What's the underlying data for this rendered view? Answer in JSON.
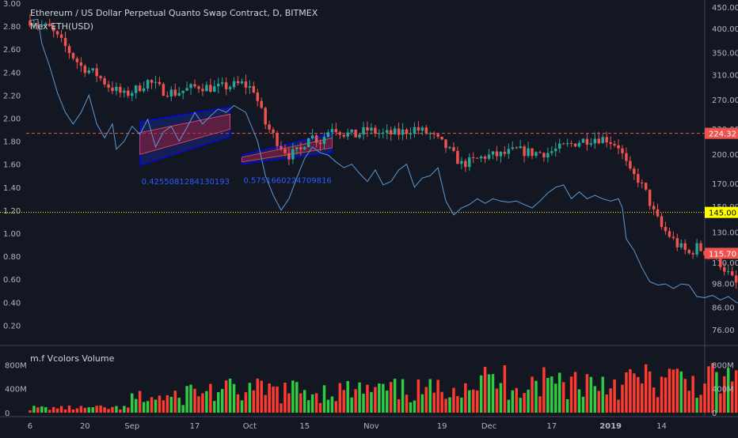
{
  "chart_data": {
    "type": "candlestick",
    "main_pane": {
      "title": "Ethereum / US Dollar Perpetual Quanto Swap Contract, D, BITMEX",
      "overlay_label": "Mex ETH(USD)",
      "left_axis": {
        "ticks": [
          "3.00",
          "2.80",
          "2.60",
          "2.40",
          "2.20",
          "2.00",
          "1.80",
          "1.60",
          "1.40",
          "1.20",
          "1.00",
          "0.80",
          "0.60",
          "0.40",
          "0.20"
        ],
        "range": [
          0.1,
          3.0
        ]
      },
      "right_axis": {
        "ticks": [
          "450.00",
          "400.00",
          "350.00",
          "310.00",
          "270.00",
          "230.00",
          "200.00",
          "170.00",
          "150.00",
          "130.00",
          "110.00",
          "98.00",
          "86.00",
          "76.00"
        ],
        "scale": "log",
        "range": [
          73,
          460
        ]
      },
      "markers": [
        {
          "label": "224.32",
          "price": 224.32,
          "color": "#ef5350",
          "style": "dashed"
        },
        {
          "label": "145.00",
          "price": 145.0,
          "color": "#ffff00",
          "style": "dotted"
        },
        {
          "label": "115.70",
          "price": 115.7,
          "color": "#ef5350",
          "style": "last"
        }
      ],
      "channel_labels": [
        "0.4255081284130193",
        "0.5751660224709816"
      ],
      "close_path": [
        [
          0,
          2.85
        ],
        [
          5,
          2.78
        ],
        [
          9,
          2.62
        ],
        [
          13,
          2.45
        ],
        [
          17,
          2.38
        ],
        [
          20,
          2.28
        ],
        [
          24,
          2.2
        ],
        [
          27,
          2.25
        ],
        [
          30,
          2.32
        ],
        [
          34,
          2.24
        ],
        [
          37,
          2.22
        ],
        [
          40,
          2.25
        ],
        [
          43,
          2.28
        ],
        [
          47,
          2.26
        ],
        [
          51,
          2.28
        ],
        [
          54,
          2.3
        ],
        [
          57,
          2.25
        ],
        [
          60,
          1.95
        ],
        [
          63,
          1.8
        ],
        [
          66,
          1.68
        ],
        [
          69,
          1.72
        ],
        [
          71,
          1.86
        ],
        [
          74,
          1.8
        ],
        [
          77,
          1.93
        ],
        [
          80,
          1.87
        ],
        [
          83,
          1.85
        ],
        [
          86,
          1.9
        ],
        [
          90,
          1.86
        ],
        [
          94,
          1.87
        ],
        [
          98,
          1.91
        ],
        [
          102,
          1.86
        ],
        [
          106,
          1.75
        ],
        [
          110,
          1.6
        ],
        [
          113,
          1.63
        ],
        [
          116,
          1.67
        ],
        [
          120,
          1.68
        ],
        [
          124,
          1.72
        ],
        [
          128,
          1.7
        ],
        [
          132,
          1.7
        ],
        [
          136,
          1.75
        ],
        [
          140,
          1.8
        ],
        [
          144,
          1.83
        ],
        [
          147,
          1.82
        ],
        [
          150,
          1.76
        ],
        [
          153,
          1.52
        ],
        [
          155,
          1.47
        ],
        [
          157,
          1.35
        ],
        [
          159,
          1.18
        ],
        [
          161,
          1.05
        ],
        [
          163,
          0.98
        ],
        [
          165,
          0.9
        ],
        [
          168,
          0.82
        ],
        [
          170,
          0.88
        ],
        [
          173,
          0.82
        ],
        [
          176,
          0.74
        ],
        [
          179,
          0.6
        ],
        [
          182,
          0.48
        ],
        [
          185,
          0.43
        ],
        [
          188,
          0.41
        ],
        [
          190,
          0.38
        ],
        [
          192,
          0.37
        ],
        [
          195,
          0.55
        ],
        [
          198,
          0.72
        ],
        [
          201,
          0.85
        ],
        [
          204,
          0.99
        ],
        [
          206,
          1.05
        ],
        [
          209,
          0.92
        ],
        [
          212,
          0.95
        ],
        [
          215,
          1.1
        ],
        [
          217,
          1.25
        ],
        [
          220,
          1.33
        ],
        [
          223,
          1.3
        ],
        [
          226,
          1.22
        ],
        [
          228,
          1.1
        ],
        [
          230,
          0.96
        ],
        [
          233,
          0.93
        ],
        [
          236,
          0.91
        ],
        [
          239,
          0.88
        ],
        [
          242,
          0.85
        ]
      ],
      "overlay_path": [
        [
          0,
          2.85
        ],
        [
          2,
          2.86
        ],
        [
          3,
          2.65
        ],
        [
          5,
          2.45
        ],
        [
          7,
          2.22
        ],
        [
          9,
          2.05
        ],
        [
          11,
          1.95
        ],
        [
          13,
          2.05
        ],
        [
          15,
          2.2
        ],
        [
          17,
          1.95
        ],
        [
          19,
          1.83
        ],
        [
          21,
          1.95
        ],
        [
          22,
          1.73
        ],
        [
          24,
          1.8
        ],
        [
          26,
          1.93
        ],
        [
          28,
          1.86
        ],
        [
          30,
          1.99
        ],
        [
          32,
          1.75
        ],
        [
          34,
          1.88
        ],
        [
          36,
          1.93
        ],
        [
          38,
          1.8
        ],
        [
          40,
          1.92
        ],
        [
          42,
          2.05
        ],
        [
          44,
          1.95
        ],
        [
          46,
          2.02
        ],
        [
          48,
          2.08
        ],
        [
          50,
          2.05
        ],
        [
          52,
          2.11
        ],
        [
          55,
          2.05
        ],
        [
          58,
          1.8
        ],
        [
          60,
          1.5
        ],
        [
          62,
          1.33
        ],
        [
          64,
          1.2
        ],
        [
          66,
          1.3
        ],
        [
          68,
          1.48
        ],
        [
          70,
          1.65
        ],
        [
          72,
          1.75
        ],
        [
          74,
          1.7
        ],
        [
          76,
          1.68
        ],
        [
          78,
          1.62
        ],
        [
          80,
          1.57
        ],
        [
          82,
          1.6
        ],
        [
          84,
          1.52
        ],
        [
          86,
          1.45
        ],
        [
          88,
          1.55
        ],
        [
          90,
          1.42
        ],
        [
          92,
          1.45
        ],
        [
          94,
          1.55
        ],
        [
          96,
          1.6
        ],
        [
          98,
          1.4
        ],
        [
          100,
          1.48
        ],
        [
          102,
          1.5
        ],
        [
          104,
          1.57
        ],
        [
          106,
          1.28
        ],
        [
          108,
          1.16
        ],
        [
          110,
          1.22
        ],
        [
          112,
          1.25
        ],
        [
          114,
          1.3
        ],
        [
          116,
          1.26
        ],
        [
          118,
          1.3
        ],
        [
          120,
          1.28
        ],
        [
          122,
          1.27
        ],
        [
          124,
          1.28
        ],
        [
          126,
          1.25
        ],
        [
          128,
          1.22
        ],
        [
          130,
          1.28
        ],
        [
          132,
          1.35
        ],
        [
          134,
          1.4
        ],
        [
          136,
          1.42
        ],
        [
          138,
          1.3
        ],
        [
          140,
          1.36
        ],
        [
          142,
          1.3
        ],
        [
          144,
          1.33
        ],
        [
          146,
          1.3
        ],
        [
          148,
          1.28
        ],
        [
          150,
          1.3
        ],
        [
          151,
          1.22
        ],
        [
          152,
          0.95
        ],
        [
          154,
          0.85
        ],
        [
          156,
          0.7
        ],
        [
          158,
          0.58
        ],
        [
          160,
          0.55
        ],
        [
          162,
          0.56
        ],
        [
          164,
          0.52
        ],
        [
          166,
          0.56
        ],
        [
          168,
          0.55
        ],
        [
          170,
          0.45
        ],
        [
          172,
          0.44
        ],
        [
          174,
          0.46
        ],
        [
          176,
          0.42
        ],
        [
          178,
          0.45
        ],
        [
          180,
          0.4
        ],
        [
          182,
          0.38
        ],
        [
          184,
          0.36
        ],
        [
          186,
          0.33
        ],
        [
          188,
          0.31
        ],
        [
          190,
          0.3
        ],
        [
          192,
          0.32
        ],
        [
          194,
          0.35
        ],
        [
          196,
          0.42
        ],
        [
          198,
          0.5
        ],
        [
          200,
          0.55
        ],
        [
          202,
          0.52
        ],
        [
          204,
          0.6
        ],
        [
          206,
          0.56
        ],
        [
          208,
          0.52
        ],
        [
          210,
          0.48
        ],
        [
          212,
          0.55
        ],
        [
          214,
          0.57
        ],
        [
          216,
          0.56
        ],
        [
          218,
          0.59
        ],
        [
          220,
          0.58
        ],
        [
          222,
          0.6
        ],
        [
          224,
          0.63
        ],
        [
          226,
          0.59
        ],
        [
          228,
          0.45
        ],
        [
          230,
          0.4
        ],
        [
          233,
          0.42
        ],
        [
          236,
          0.4
        ],
        [
          239,
          0.43
        ],
        [
          242,
          0.38
        ]
      ]
    },
    "volume_pane": {
      "title": "m.f Vcolors Volume",
      "right_axis": {
        "ticks": [
          "800M",
          "400M",
          "0"
        ]
      },
      "left_axis": {
        "ticks": [
          "800M",
          "400M",
          "0"
        ]
      },
      "range": [
        0,
        950
      ]
    },
    "x_axis": {
      "ticks": [
        {
          "label": "6",
          "day": 0
        },
        {
          "label": "20",
          "day": 14
        },
        {
          "label": "Sep",
          "day": 26
        },
        {
          "label": "17",
          "day": 42
        },
        {
          "label": "Oct",
          "day": 56
        },
        {
          "label": "15",
          "day": 70
        },
        {
          "label": "Nov",
          "day": 87
        },
        {
          "label": "19",
          "day": 105
        },
        {
          "label": "Dec",
          "day": 117
        },
        {
          "label": "17",
          "day": 133
        },
        {
          "label": "2019",
          "day": 148
        },
        {
          "label": "14",
          "day": 161
        }
      ],
      "range": [
        -1,
        172
      ]
    },
    "colors": {
      "up": "#26a69a",
      "down": "#ef5350",
      "volume_up": "#2ecc40",
      "volume_down": "#ff3b30",
      "overlay": "#5b9bd5",
      "channel": "#0000ff"
    }
  }
}
